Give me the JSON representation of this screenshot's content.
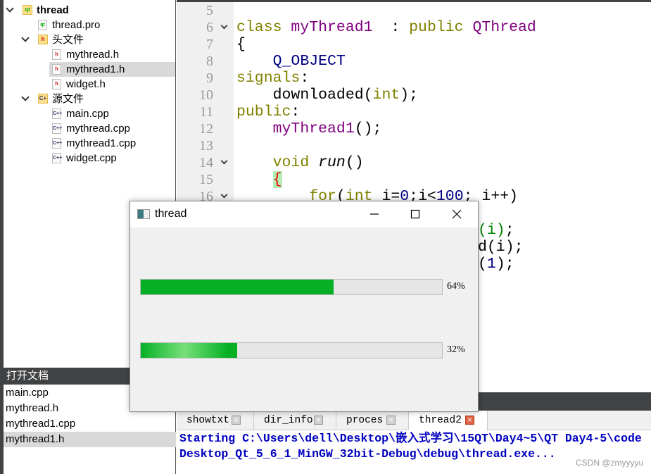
{
  "project_tree": [
    {
      "label": "thread",
      "level": 0,
      "kind": "project",
      "expanded": true,
      "bold": true
    },
    {
      "label": "thread.pro",
      "level": 1,
      "kind": "pro"
    },
    {
      "label": "头文件",
      "level": 1,
      "kind": "folder-h",
      "expanded": true
    },
    {
      "label": "mythread.h",
      "level": 2,
      "kind": "h"
    },
    {
      "label": "mythread1.h",
      "level": 2,
      "kind": "h",
      "selected": true
    },
    {
      "label": "widget.h",
      "level": 2,
      "kind": "h"
    },
    {
      "label": "源文件",
      "level": 1,
      "kind": "folder-cpp",
      "expanded": true
    },
    {
      "label": "main.cpp",
      "level": 2,
      "kind": "cpp"
    },
    {
      "label": "mythread.cpp",
      "level": 2,
      "kind": "cpp"
    },
    {
      "label": "mythread1.cpp",
      "level": 2,
      "kind": "cpp"
    },
    {
      "label": "widget.cpp",
      "level": 2,
      "kind": "cpp"
    }
  ],
  "open_documents": {
    "title": "打开文档",
    "items": [
      "main.cpp",
      "mythread.h",
      "mythread1.cpp",
      "mythread1.h"
    ],
    "selected": "mythread1.h"
  },
  "editor": {
    "lines": [
      {
        "n": "5",
        "fold": false,
        "tokens": []
      },
      {
        "n": "6",
        "fold": true,
        "tokens": [
          [
            "kw",
            "class "
          ],
          [
            "ty",
            "myThread1"
          ],
          [
            "",
            "  : "
          ],
          [
            "kw",
            "public "
          ],
          [
            "ty",
            "QThread"
          ]
        ]
      },
      {
        "n": "7",
        "fold": false,
        "tokens": [
          [
            "",
            "{"
          ]
        ]
      },
      {
        "n": "8",
        "fold": false,
        "tokens": [
          [
            "",
            "    "
          ],
          [
            "nm",
            "Q_OBJECT"
          ]
        ]
      },
      {
        "n": "9",
        "fold": false,
        "tokens": [
          [
            "kw",
            "signals"
          ],
          [
            "",
            ":"
          ]
        ]
      },
      {
        "n": "10",
        "fold": false,
        "tokens": [
          [
            "",
            "    downloaded("
          ],
          [
            "kw",
            "int"
          ],
          [
            "",
            ");"
          ]
        ]
      },
      {
        "n": "11",
        "fold": false,
        "tokens": [
          [
            "kw",
            "public"
          ],
          [
            "",
            ":"
          ]
        ]
      },
      {
        "n": "12",
        "fold": false,
        "tokens": [
          [
            "",
            "    "
          ],
          [
            "ty",
            "myThread1"
          ],
          [
            "",
            "();"
          ]
        ]
      },
      {
        "n": "13",
        "fold": false,
        "tokens": []
      },
      {
        "n": "14",
        "fold": true,
        "tokens": [
          [
            "",
            "    "
          ],
          [
            "kw",
            "void "
          ],
          [
            "fn",
            "run"
          ],
          [
            "",
            "()"
          ]
        ]
      },
      {
        "n": "15",
        "fold": false,
        "tokens": [
          [
            "",
            "    "
          ],
          [
            "br",
            "{"
          ]
        ]
      },
      {
        "n": "16",
        "fold": true,
        "tokens": [
          [
            "",
            "        "
          ],
          [
            "kw",
            "for"
          ],
          [
            "",
            "("
          ],
          [
            "kw",
            "int "
          ],
          [
            "",
            "i="
          ],
          [
            "num",
            "0"
          ],
          [
            "",
            ";i<"
          ],
          [
            "num",
            "100"
          ],
          [
            "",
            "; i++)"
          ]
        ]
      }
    ],
    "partial_lines": [
      {
        "tokens": [
          [
            "gr",
            "(i)"
          ],
          [
            "",
            ";"
          ]
        ]
      },
      {
        "tokens": [
          [
            "",
            "d(i);"
          ]
        ]
      },
      {
        "tokens": [
          [
            "",
            "("
          ],
          [
            "num",
            "1"
          ],
          [
            "",
            ");"
          ]
        ]
      }
    ]
  },
  "output_tabs": [
    {
      "label": "showtxt"
    },
    {
      "label": "dir_info"
    },
    {
      "label": "proces"
    },
    {
      "label": "thread2",
      "active": true
    }
  ],
  "output_lines": [
    "Starting C:\\Users\\dell\\Desktop\\嵌入式学习\\15QT\\Day4~5\\QT Day4-5\\code",
    "Desktop_Qt_5_6_1_MinGW_32bit-Debug\\debug\\thread.exe..."
  ],
  "watermark": "CSDN @zmyyyyu",
  "dialog": {
    "title": "thread",
    "progress": [
      {
        "value": 64,
        "label": "64%"
      },
      {
        "value": 32,
        "label": "32%"
      }
    ]
  },
  "colors": {
    "progress_fill": "#06b025",
    "output_text": "#0000c0",
    "panel_dark": "#404244"
  }
}
